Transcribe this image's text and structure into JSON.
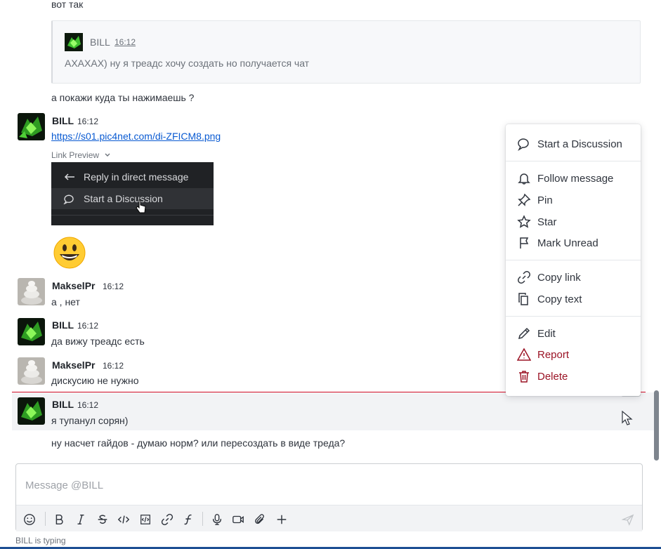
{
  "messages": {
    "top_text": "вот так",
    "quote": {
      "name": "BILL",
      "time": "16:12",
      "text": "АХАХАХ) ну я треадс хочу создать но получается чат"
    },
    "msg_ask": "а покажи куда ты нажимаешь ?",
    "bill1": {
      "name": "BILL",
      "time": "16:12",
      "link": "https://s01.pic4net.com/di-ZFICM8.png",
      "link_preview_label": "Link Preview"
    },
    "preview": {
      "reply_label": "Reply in direct message",
      "discussion_label": "Start a Discussion"
    },
    "maksel1": {
      "name": "MakselPr",
      "time": "16:12",
      "text": "а , нет"
    },
    "bill2": {
      "name": "BILL",
      "time": "16:12",
      "text": "да вижу треадс есть"
    },
    "maksel2": {
      "name": "MakselPr",
      "time": "16:12",
      "text": "дискусию не нужно"
    },
    "bill3": {
      "name": "BILL",
      "time": "16:12",
      "text": "я тупанул сорян)"
    },
    "follow_up": "ну насчет гайдов - думаю норм? или пересоздать в виде треда?"
  },
  "menu": {
    "start_discussion": "Start a Discussion",
    "follow": "Follow message",
    "pin": "Pin",
    "star": "Star",
    "mark_unread": "Mark Unread",
    "copy_link": "Copy link",
    "copy_text": "Copy text",
    "edit": "Edit",
    "report": "Report",
    "delete": "Delete"
  },
  "composer": {
    "placeholder": "Message @BILL",
    "typing": "BILL is typing"
  },
  "colors": {
    "danger": "#9b1325",
    "link": "#095ad2",
    "unread_line": "#d40c26"
  },
  "icons": [
    "emoji-icon",
    "bold-icon",
    "italic-icon",
    "strike-icon",
    "code-icon",
    "code-block-icon",
    "link-icon",
    "formula-icon",
    "microphone-icon",
    "video-icon",
    "attachment-icon",
    "plus-icon",
    "send-icon"
  ]
}
